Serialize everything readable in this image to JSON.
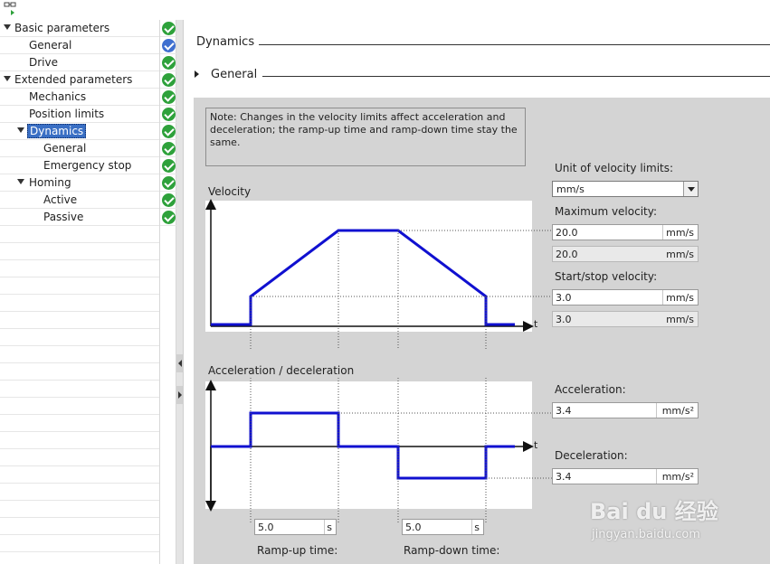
{
  "tree": {
    "items": [
      {
        "label": "Basic parameters",
        "level": 0,
        "expanded": true,
        "status": "ok"
      },
      {
        "label": "General",
        "level": 1,
        "status": "info"
      },
      {
        "label": "Drive",
        "level": 1,
        "status": "ok"
      },
      {
        "label": "Extended parameters",
        "level": 0,
        "expanded": true,
        "status": "ok"
      },
      {
        "label": "Mechanics",
        "level": 1,
        "status": "ok"
      },
      {
        "label": "Position limits",
        "level": 1,
        "status": "ok"
      },
      {
        "label": "Dynamics",
        "level": 1,
        "expanded": true,
        "selected": true,
        "status": "ok"
      },
      {
        "label": "General",
        "level": 2,
        "status": "ok"
      },
      {
        "label": "Emergency stop",
        "level": 2,
        "status": "ok"
      },
      {
        "label": "Homing",
        "level": 1,
        "expanded": true,
        "status": "ok"
      },
      {
        "label": "Active",
        "level": 2,
        "status": "ok"
      },
      {
        "label": "Passive",
        "level": 2,
        "status": "ok"
      }
    ]
  },
  "content": {
    "section_title": "Dynamics",
    "subsection_title": "General",
    "note": "Note: Changes in the velocity limits affect acceleration and deceleration; the ramp-up time and ramp-down time stay the same.",
    "velocity_chart_title": "Velocity",
    "accel_chart_title": "Acceleration / deceleration",
    "axis_t": "t",
    "unit_velocity_label": "Unit of velocity limits:",
    "unit_velocity_value": "mm/s",
    "max_velocity_label": "Maximum velocity:",
    "max_velocity_value": "20.0",
    "max_velocity_unit": "mm/s",
    "max_velocity_ro_value": "20.0",
    "max_velocity_ro_unit": "mm/s",
    "start_stop_label": "Start/stop velocity:",
    "start_stop_value": "3.0",
    "start_stop_unit": "mm/s",
    "start_stop_ro_value": "3.0",
    "start_stop_ro_unit": "mm/s",
    "acceleration_label": "Acceleration:",
    "acceleration_value": "3.4",
    "acceleration_unit": "mm/s²",
    "deceleration_label": "Deceleration:",
    "deceleration_value": "3.4",
    "deceleration_unit": "mm/s²",
    "ramp_up_value": "5.0",
    "ramp_up_unit": "s",
    "ramp_up_label": "Ramp-up time:",
    "ramp_down_value": "5.0",
    "ramp_down_unit": "s",
    "ramp_down_label": "Ramp-down time:"
  },
  "watermark": {
    "logo_text": "Bai du 经验",
    "url_text": "jingyan.baidu.com"
  },
  "colors": {
    "accent_blue": "#1010d0",
    "status_ok": "#2ea13b",
    "status_info": "#3f6fcf",
    "selection": "#3a6fc4"
  }
}
